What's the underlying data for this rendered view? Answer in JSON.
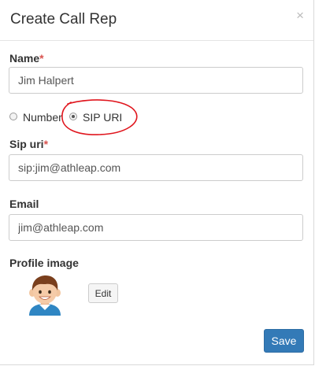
{
  "modal": {
    "title": "Create Call Rep",
    "close_glyph": "×"
  },
  "form": {
    "name": {
      "label": "Name",
      "required_mark": "*",
      "value": "Jim Halpert"
    },
    "type_radio": {
      "options": [
        {
          "label": "Number",
          "checked": false
        },
        {
          "label": "SIP URI",
          "checked": true
        }
      ]
    },
    "sip_uri": {
      "label": "Sip uri",
      "required_mark": "*",
      "value": "sip:jim@athleap.com"
    },
    "email": {
      "label": "Email",
      "value": "jim@athleap.com"
    },
    "profile_image": {
      "label": "Profile image",
      "avatar_icon": "person-avatar-icon",
      "edit_label": "Edit"
    }
  },
  "footer": {
    "save_label": "Save"
  },
  "colors": {
    "primary": "#337ab7",
    "required": "#d9534f",
    "annotation": "#e0161e"
  }
}
